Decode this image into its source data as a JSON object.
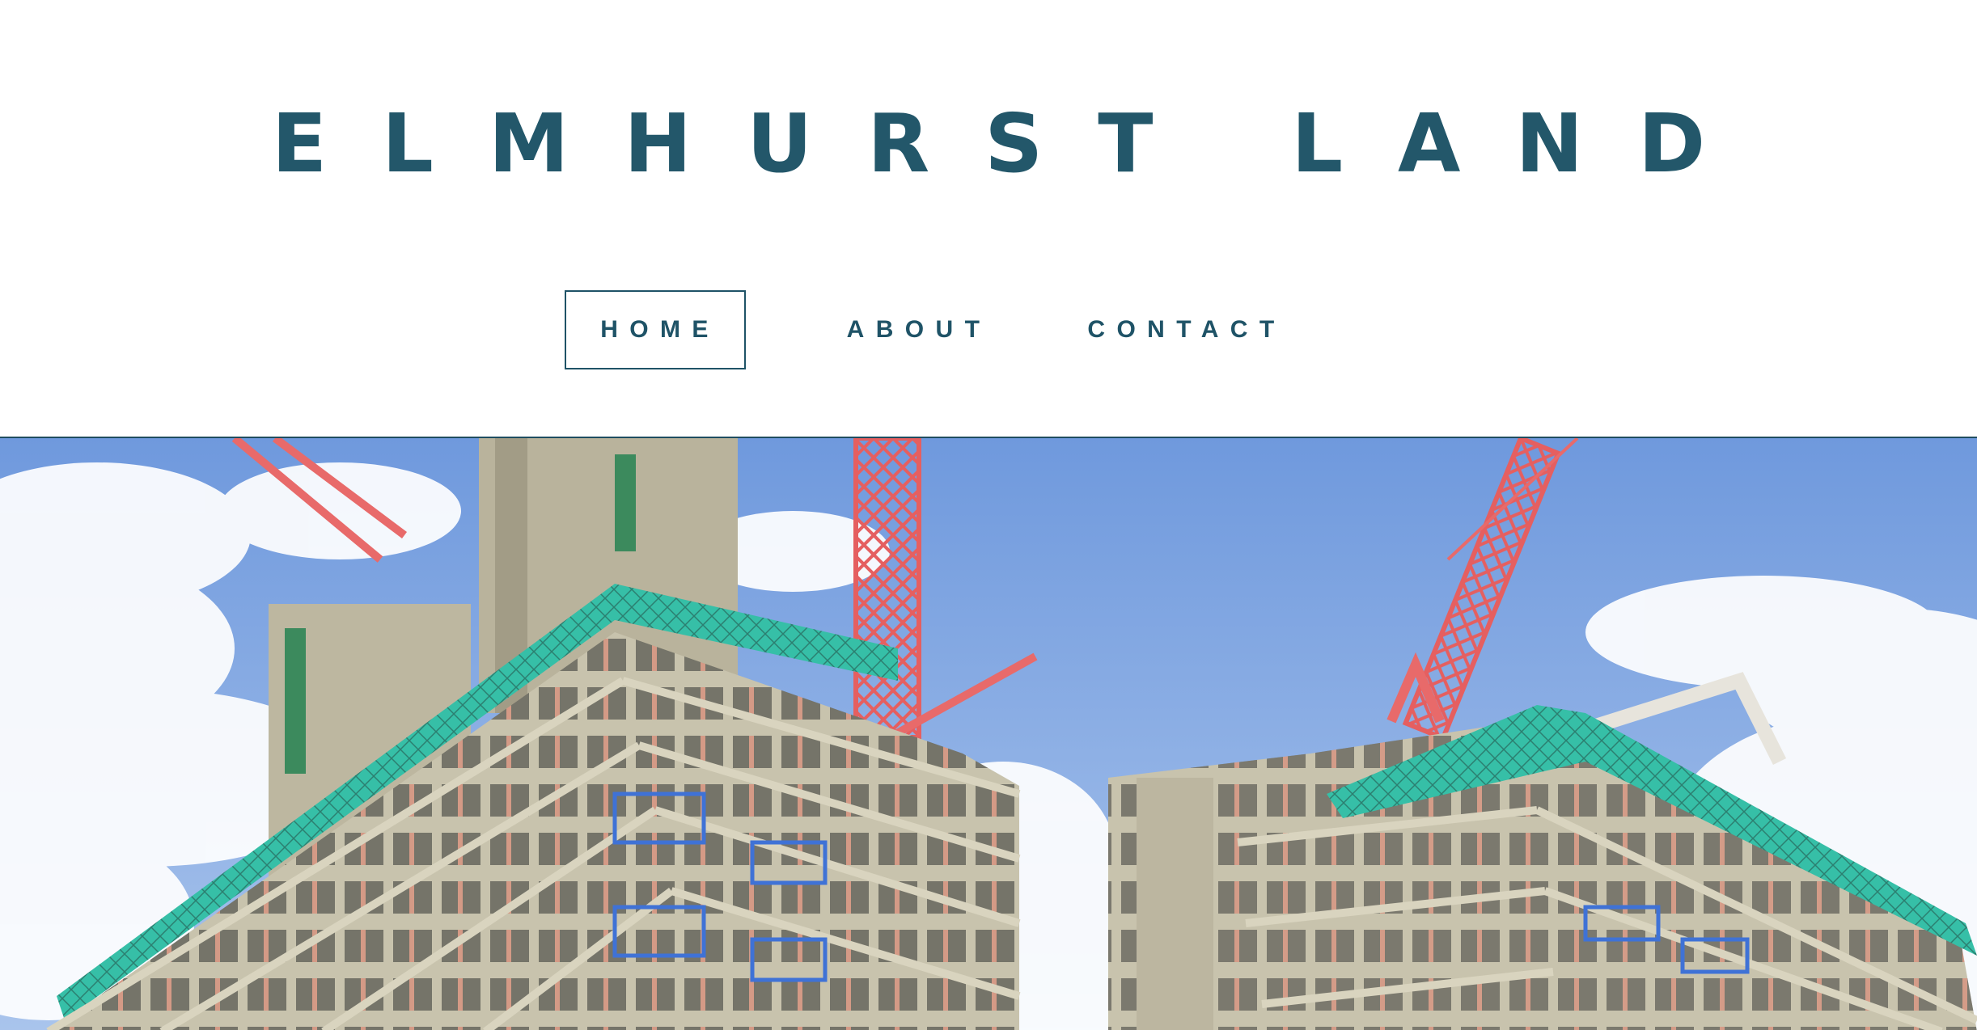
{
  "site": {
    "title": "ELMHURST LAND"
  },
  "nav": {
    "items": [
      {
        "label": "HOME",
        "active": true
      },
      {
        "label": "ABOUT",
        "active": false
      },
      {
        "label": "CONTACT",
        "active": false
      }
    ]
  },
  "colors": {
    "brand": "#23576a",
    "nav_text": "#1f5367",
    "sky": "#7fa6df",
    "crane": "#e86a6a",
    "concrete": "#c9c4ae",
    "safety_netting": "#3fc9b4"
  },
  "hero": {
    "image": "construction-site-photo"
  }
}
